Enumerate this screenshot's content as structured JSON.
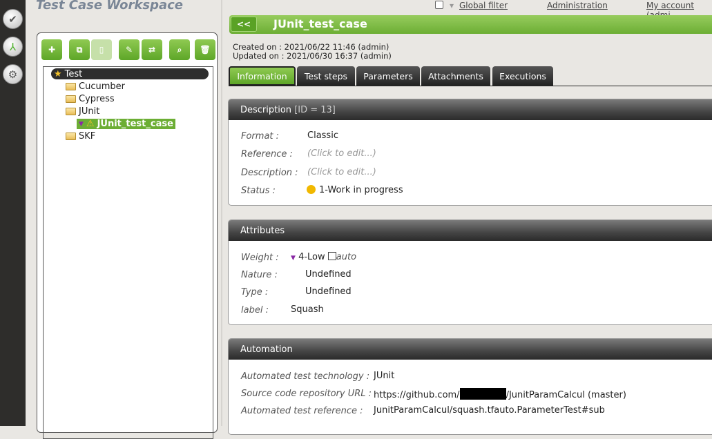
{
  "workspace": {
    "title": "Test Case Workspace"
  },
  "nav": {
    "icons": [
      "check-icon",
      "hierarchy-icon",
      "gears-icon"
    ]
  },
  "toolbar": {
    "buttons": [
      "add",
      "copy",
      "paste",
      "rename",
      "move",
      "search",
      "delete"
    ]
  },
  "tree": {
    "root": "Test",
    "folders": [
      "Cucumber",
      "Cypress",
      "JUnit",
      "SKF"
    ],
    "selected": "JUnit_test_case"
  },
  "toplinks": {
    "global_filter": "Global filter",
    "administration": "Administration",
    "account": "My account (admi"
  },
  "header": {
    "back": "<<",
    "title": "JUnit_test_case"
  },
  "meta": {
    "created": "Created on :  2021/06/22 11:46 (admin)",
    "updated": "Updated on :  2021/06/30 16:37 (admin)"
  },
  "tabs": [
    "Information",
    "Test steps",
    "Parameters",
    "Attachments",
    "Executions"
  ],
  "description": {
    "title": "Description",
    "id": "[ID = 13]",
    "format_label": "Format :",
    "format": "Classic",
    "reference_label": "Reference :",
    "reference": "(Click to edit...)",
    "description_label": "Description :",
    "description": "(Click to edit...)",
    "status_label": "Status :",
    "status": "1-Work in progress",
    "status_color": "#f1b800"
  },
  "attributes": {
    "title": "Attributes",
    "weight_label": "Weight :",
    "weight": "4-Low",
    "auto": "auto",
    "nature_label": "Nature :",
    "nature": "Undefined",
    "type_label": "Type  :",
    "type": "Undefined",
    "label_label": "label :",
    "label": "Squash"
  },
  "automation": {
    "title": "Automation",
    "tech_label": "Automated test technology  :",
    "tech": "JUnit",
    "url_label": "Source code repository URL  :",
    "url_prefix": "https://github.com/",
    "url_suffix": "/JunitParamCalcul (master)",
    "ref_label": "Automated test reference  :",
    "ref": "JunitParamCalcul/squash.tfauto.ParameterTest#sub"
  }
}
